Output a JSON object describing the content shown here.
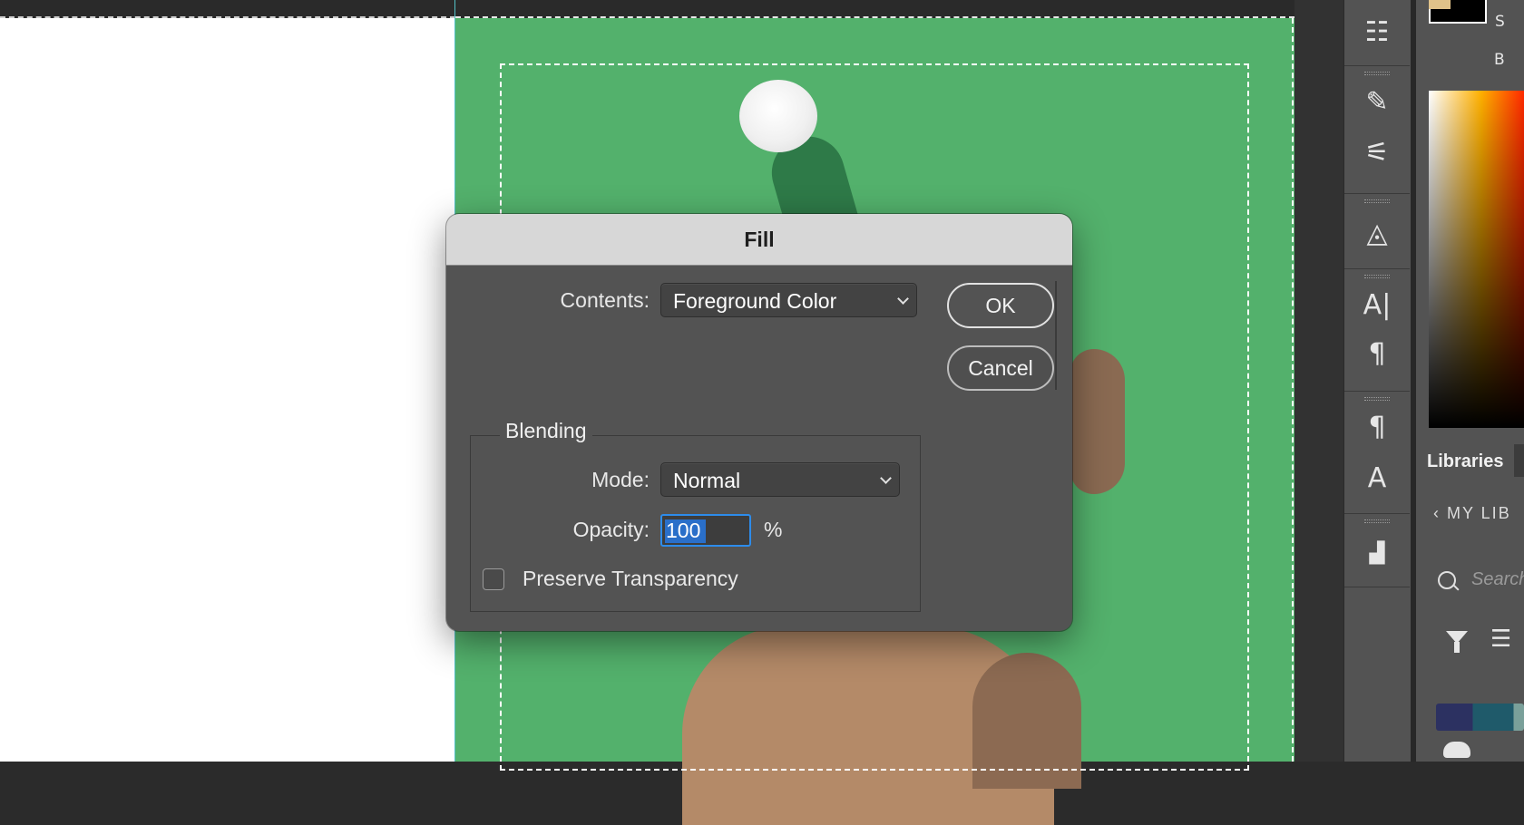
{
  "dialog": {
    "title": "Fill",
    "contents_label": "Contents:",
    "contents_value": "Foreground Color",
    "ok_label": "OK",
    "cancel_label": "Cancel",
    "blending_title": "Blending",
    "mode_label": "Mode:",
    "mode_value": "Normal",
    "opacity_label": "Opacity:",
    "opacity_value": "100",
    "opacity_unit": "%",
    "preserve_transparency_label": "Preserve Transparency",
    "preserve_transparency_checked": false
  },
  "color_panel": {
    "s_label": "S",
    "b_label": "B"
  },
  "libraries": {
    "tab_label": "Libraries",
    "back_label": "MY LIB",
    "search_placeholder": "Search"
  },
  "toolbar": {
    "icons": [
      "adjustments-sliders-icon",
      "brush-presets-icon",
      "brush-settings-icon",
      "shapes-icon",
      "character-icon",
      "paragraph-icon",
      "paragraph-styles-icon",
      "character-styles-icon",
      "glyphs-icon"
    ]
  },
  "colors": {
    "document_green": "#53b16c",
    "dialog_bg": "#535353",
    "titlebar": "#d7d7d7",
    "focus_blue": "#2d8ceb"
  }
}
